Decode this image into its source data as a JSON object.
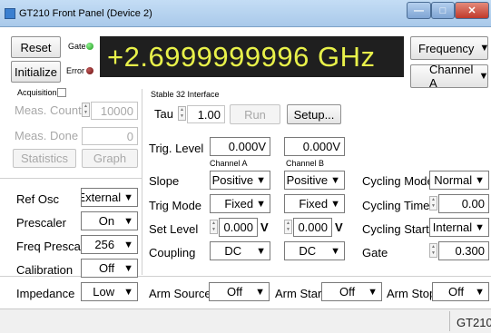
{
  "window": {
    "title": "GT210 Front Panel  (Device 2)"
  },
  "top": {
    "reset_label": "Reset",
    "initialize_label": "Initialize",
    "gate_label": "Gate",
    "error_label": "Error",
    "display_value": "+2.6999999996 GHz",
    "frequency_label": "Frequency",
    "channel_label": "Channel A"
  },
  "acquisition": {
    "label": "Acquisition",
    "meas_count_label": "Meas. Count",
    "meas_count_value": "10000",
    "meas_done_label": "Meas. Done",
    "meas_done_value": "0",
    "statistics_label": "Statistics",
    "graph_label": "Graph"
  },
  "interface": {
    "title": "Stable 32 Interface",
    "tau_label": "Tau",
    "tau_value": "1.00",
    "run_label": "Run",
    "setup_label": "Setup..."
  },
  "channels": {
    "trig_level_label": "Trig. Level",
    "a_trig_level": "0.000V",
    "b_trig_level": "0.000V",
    "a_header": "Channel A",
    "b_header": "Channel B",
    "slope_label": "Slope",
    "a_slope": "Positive",
    "b_slope": "Positive",
    "trig_mode_label": "Trig Mode",
    "a_trig_mode": "Fixed",
    "b_trig_mode": "Fixed",
    "set_level_label": "Set Level",
    "a_set_level": "0.000",
    "b_set_level": "0.000",
    "unit_v": "V",
    "coupling_label": "Coupling",
    "a_coupling": "DC",
    "b_coupling": "DC"
  },
  "cycling": {
    "mode_label": "Cycling Mode",
    "mode_value": "Normal",
    "time_label": "Cycling Time",
    "time_value": "0.00",
    "start_label": "Cycling Start",
    "start_value": "Internal",
    "gate_label": "Gate",
    "gate_value": "0.300"
  },
  "settings": {
    "ref_osc_label": "Ref Osc",
    "ref_osc_value": "External",
    "prescaler_label": "Prescaler",
    "prescaler_value": "On",
    "freq_prescale_label": "Freq Prescale",
    "freq_prescale_value": "256",
    "calibration_label": "Calibration",
    "calibration_value": "Off",
    "impedance_label": "Impedance",
    "impedance_value": "Low"
  },
  "arm": {
    "source_label": "Arm Source",
    "source_value": "Off",
    "start_label": "Arm Start",
    "start_value": "Off",
    "stop_label": "Arm Stop",
    "stop_value": "Off"
  },
  "status": {
    "device": "GT210"
  },
  "colors": {
    "display_bg": "#1f1f1f",
    "display_text": "#e8f14a",
    "gate_led": "#1b9a1b",
    "error_led": "#6a0c0c"
  }
}
